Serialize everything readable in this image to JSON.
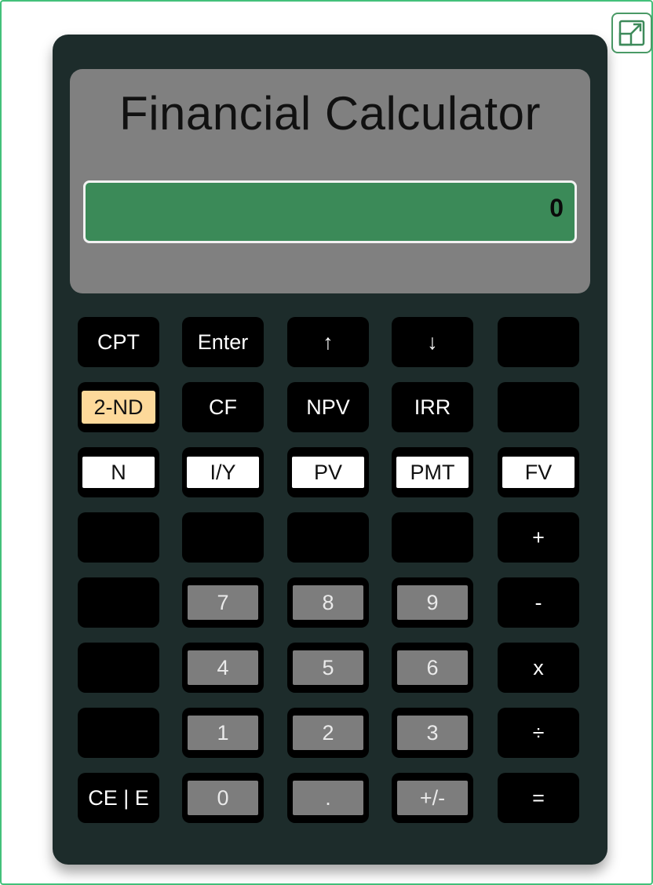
{
  "calculator": {
    "title": "Financial Calculator",
    "display_value": "0"
  },
  "keys": [
    {
      "name": "cpt-key",
      "label": "CPT",
      "style": "black"
    },
    {
      "name": "enter-key",
      "label": "Enter",
      "style": "black"
    },
    {
      "name": "up-arrow-key",
      "label": "↑",
      "style": "black"
    },
    {
      "name": "down-arrow-key",
      "label": "↓",
      "style": "black"
    },
    {
      "name": "blank-key-r1c5",
      "label": "",
      "style": "blank"
    },
    {
      "name": "second-function-key",
      "label": "2-ND",
      "style": "beige"
    },
    {
      "name": "cf-key",
      "label": "CF",
      "style": "black"
    },
    {
      "name": "npv-key",
      "label": "NPV",
      "style": "black"
    },
    {
      "name": "irr-key",
      "label": "IRR",
      "style": "black"
    },
    {
      "name": "blank-key-r2c5",
      "label": "",
      "style": "blank"
    },
    {
      "name": "n-key",
      "label": "N",
      "style": "white"
    },
    {
      "name": "iy-key",
      "label": "I/Y",
      "style": "white"
    },
    {
      "name": "pv-key",
      "label": "PV",
      "style": "white"
    },
    {
      "name": "pmt-key",
      "label": "PMT",
      "style": "white"
    },
    {
      "name": "fv-key",
      "label": "FV",
      "style": "white"
    },
    {
      "name": "blank-key-r4c1",
      "label": "",
      "style": "blank"
    },
    {
      "name": "blank-key-r4c2",
      "label": "",
      "style": "blank"
    },
    {
      "name": "blank-key-r4c3",
      "label": "",
      "style": "blank"
    },
    {
      "name": "blank-key-r4c4",
      "label": "",
      "style": "blank"
    },
    {
      "name": "plus-key",
      "label": "+",
      "style": "black"
    },
    {
      "name": "blank-key-r5c1",
      "label": "",
      "style": "blank"
    },
    {
      "name": "digit-7-key",
      "label": "7",
      "style": "gray"
    },
    {
      "name": "digit-8-key",
      "label": "8",
      "style": "gray"
    },
    {
      "name": "digit-9-key",
      "label": "9",
      "style": "gray"
    },
    {
      "name": "minus-key",
      "label": "-",
      "style": "black"
    },
    {
      "name": "blank-key-r6c1",
      "label": "",
      "style": "blank"
    },
    {
      "name": "digit-4-key",
      "label": "4",
      "style": "gray"
    },
    {
      "name": "digit-5-key",
      "label": "5",
      "style": "gray"
    },
    {
      "name": "digit-6-key",
      "label": "6",
      "style": "gray"
    },
    {
      "name": "multiply-key",
      "label": "x",
      "style": "black"
    },
    {
      "name": "blank-key-r7c1",
      "label": "",
      "style": "blank"
    },
    {
      "name": "digit-1-key",
      "label": "1",
      "style": "gray"
    },
    {
      "name": "digit-2-key",
      "label": "2",
      "style": "gray"
    },
    {
      "name": "digit-3-key",
      "label": "3",
      "style": "gray"
    },
    {
      "name": "divide-key",
      "label": "÷",
      "style": "black"
    },
    {
      "name": "clear-entry-key",
      "label": "CE | E",
      "style": "black"
    },
    {
      "name": "digit-0-key",
      "label": "0",
      "style": "gray"
    },
    {
      "name": "decimal-key",
      "label": ".",
      "style": "gray"
    },
    {
      "name": "sign-toggle-key",
      "label": "+/-",
      "style": "gray"
    },
    {
      "name": "equals-key",
      "label": "=",
      "style": "black"
    }
  ],
  "colors": {
    "body": "#1d2c2b",
    "display_panel": "#808080",
    "screen": "#3b8a58",
    "second_key": "#fdd99a",
    "digit_key": "#7d7d7d",
    "frame_border": "#43c07a"
  },
  "icons": {
    "expand": "expand-icon"
  }
}
